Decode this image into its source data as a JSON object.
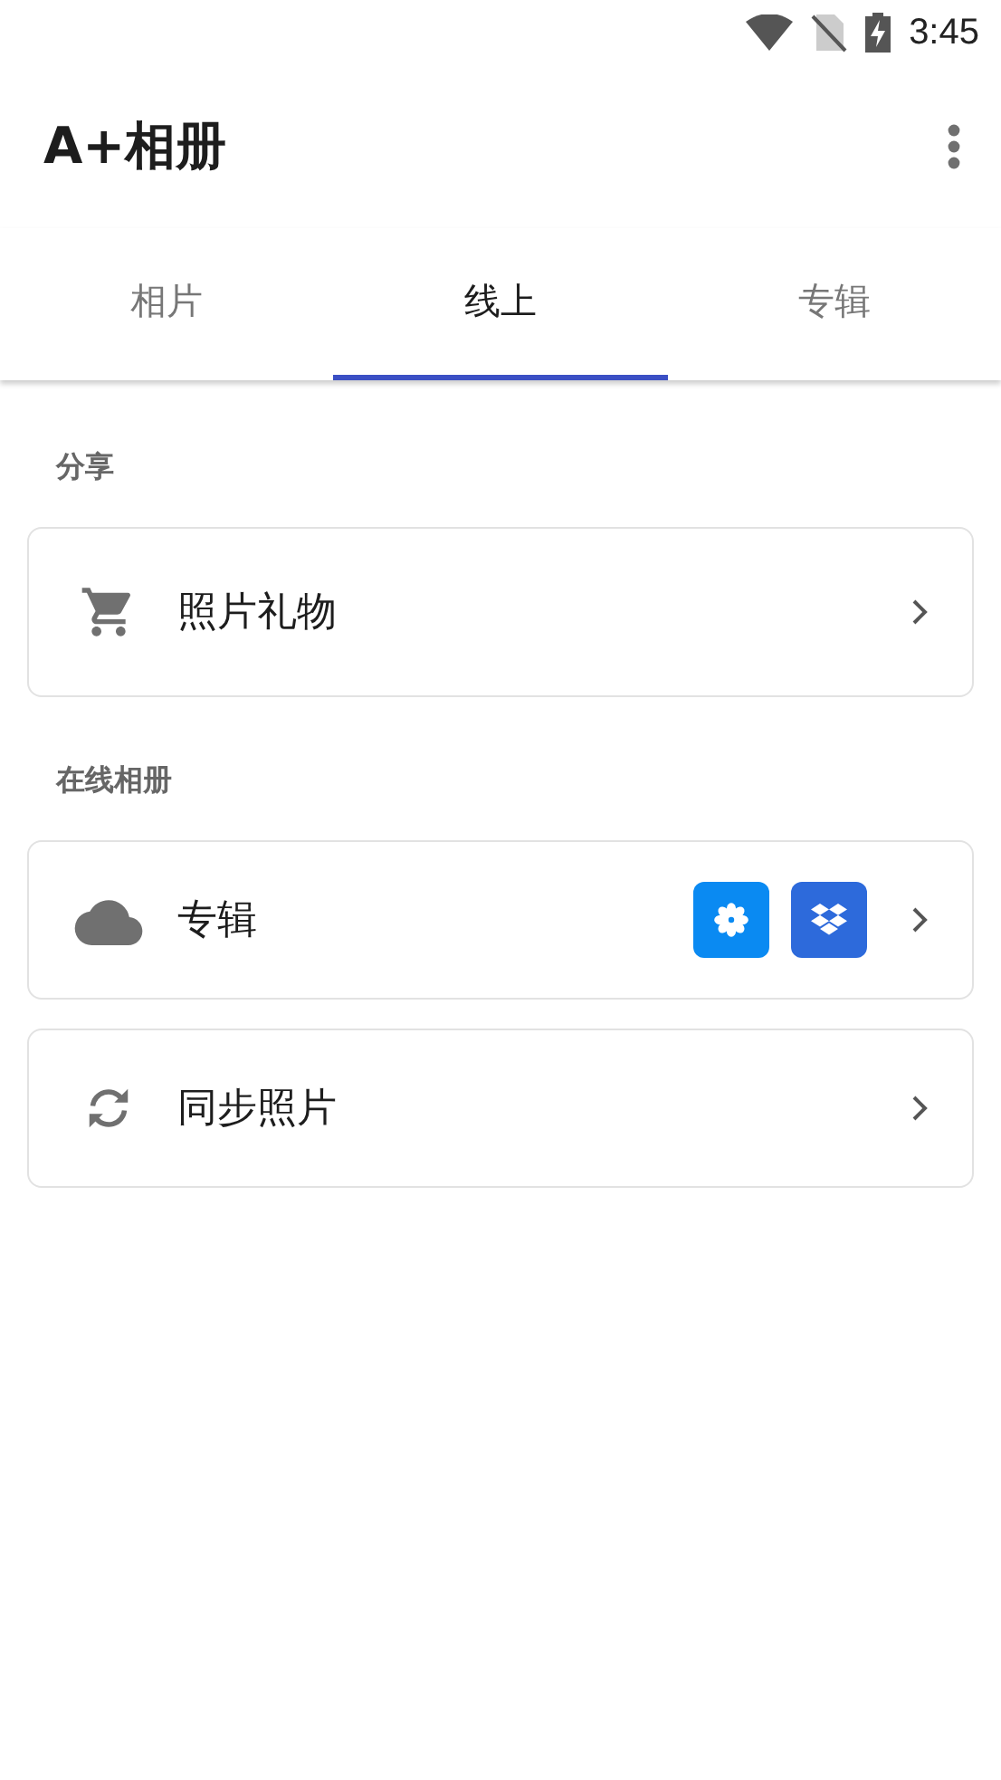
{
  "status_bar": {
    "time": "3:45"
  },
  "app_bar": {
    "title": "A+相册"
  },
  "tabs": [
    {
      "label": "相片",
      "selected": false
    },
    {
      "label": "线上",
      "selected": true
    },
    {
      "label": "专辑",
      "selected": false
    }
  ],
  "sections": [
    {
      "header": "分享",
      "items": [
        {
          "label": "照片礼物"
        }
      ]
    },
    {
      "header": "在线相册",
      "items": [
        {
          "label": "专辑",
          "services": [
            {
              "color": "#0a8af2"
            },
            {
              "color": "#2d6adb"
            }
          ]
        },
        {
          "label": "同步照片"
        }
      ]
    }
  ]
}
